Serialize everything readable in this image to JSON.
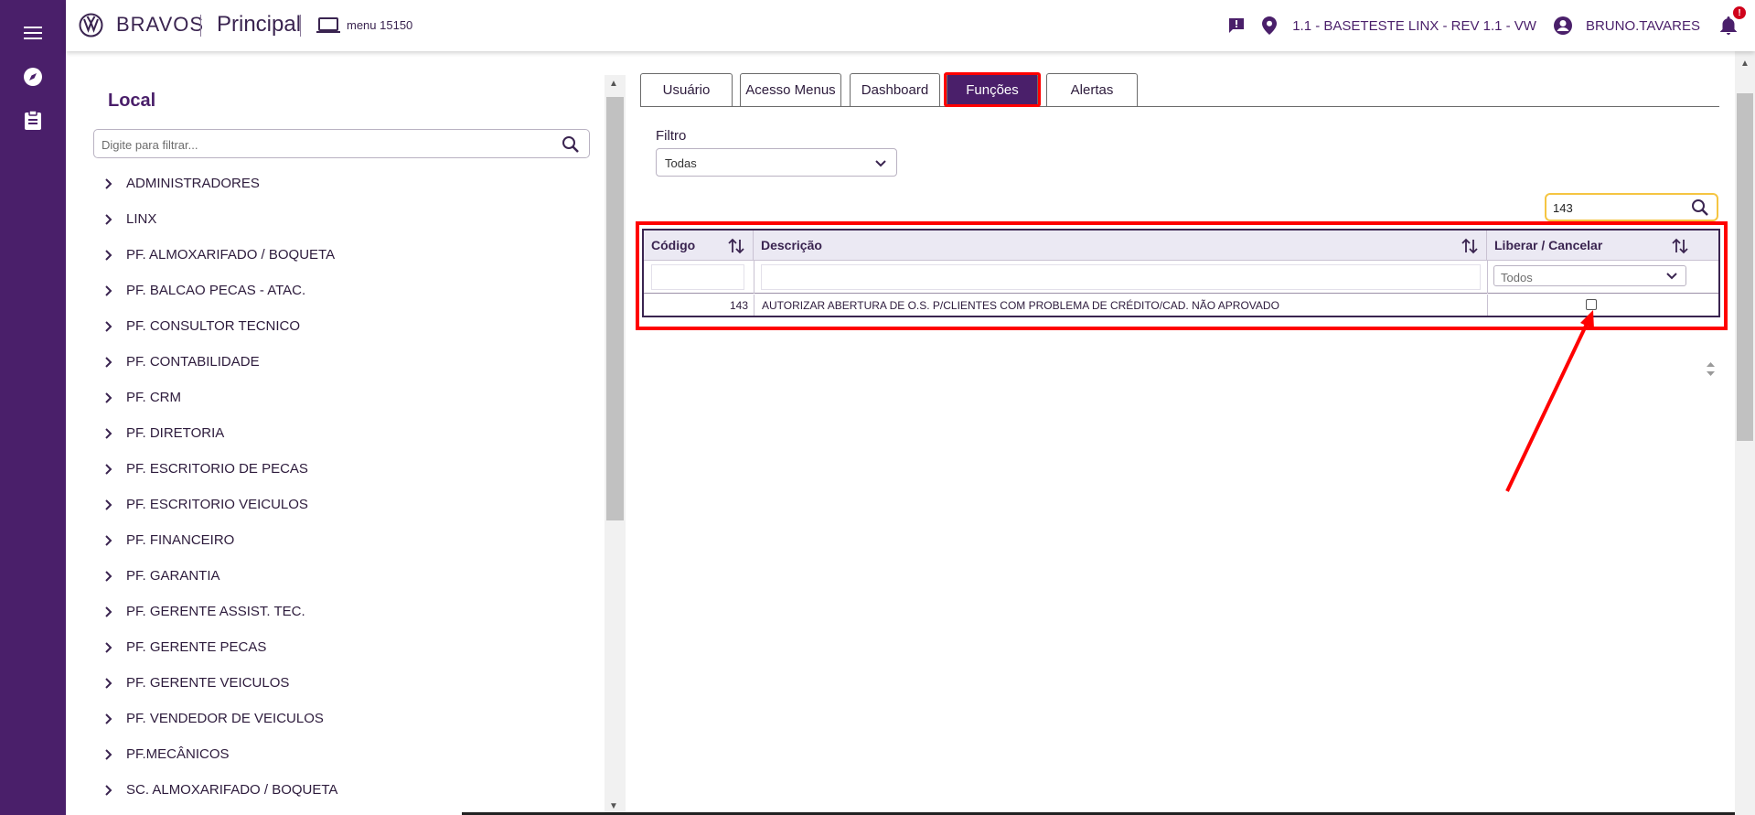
{
  "header": {
    "brand": "BRAVOS",
    "module": "Principal",
    "menu_code": "menu 15150",
    "location": "1.1 - BASETESTE LINX - REV 1.1 - VW",
    "user": "BRUNO.TAVARES",
    "notification_badge": "!"
  },
  "rail": {
    "icons": [
      "menu-icon",
      "compass-icon",
      "clipboard-icon"
    ]
  },
  "left_panel": {
    "title": "Local",
    "search_placeholder": "Digite para filtrar...",
    "items": [
      "ADMINISTRADORES",
      "LINX",
      "PF. ALMOXARIFADO / BOQUETA",
      "PF. BALCAO PECAS - ATAC.",
      "PF. CONSULTOR TECNICO",
      "PF. CONTABILIDADE",
      "PF. CRM",
      "PF. DIRETORIA",
      "PF. ESCRITORIO DE PECAS",
      "PF. ESCRITORIO VEICULOS",
      "PF. FINANCEIRO",
      "PF. GARANTIA",
      "PF. GERENTE ASSIST. TEC.",
      "PF. GERENTE PECAS",
      "PF. GERENTE VEICULOS",
      "PF. VENDEDOR DE VEICULOS",
      "PF.MECÂNICOS",
      "SC. ALMOXARIFADO / BOQUETA"
    ]
  },
  "tabs": [
    "Usuário",
    "Acesso Menus",
    "Dashboard",
    "Funções",
    "Alertas"
  ],
  "active_tab": "Funções",
  "filter": {
    "label": "Filtro",
    "value": "Todas"
  },
  "grid_search": {
    "value": "143"
  },
  "grid": {
    "columns": [
      "Código",
      "Descrição",
      "Liberar / Cancelar"
    ],
    "status_filter": "Todos",
    "rows": [
      {
        "code": "143",
        "description": "AUTORIZAR ABERTURA DE O.S. P/CLIENTES COM PROBLEMA DE CRÉDITO/CAD. NÃO APROVADO",
        "checked": false
      }
    ]
  },
  "colors": {
    "brand_purple": "#4a1f6a",
    "annotation_red": "#ff0000",
    "search_highlight": "#f5c542"
  }
}
